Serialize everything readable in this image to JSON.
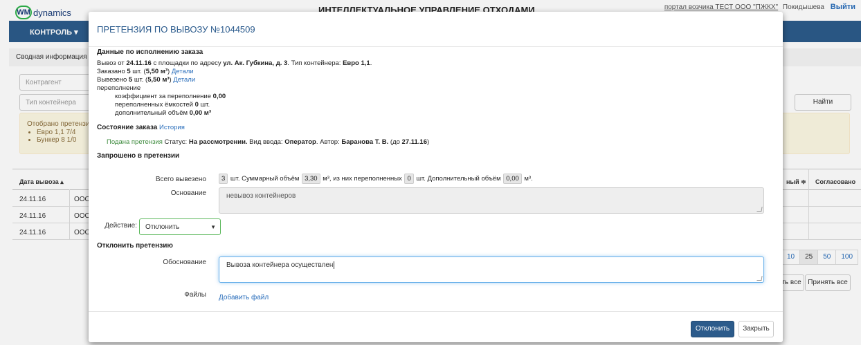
{
  "app": {
    "logo_mark": "WM",
    "logo_text": "dynamics",
    "title": "ИНТЕЛЛЕКТУАЛЬНОЕ УПРАВЛЕНИЕ ОТХОДАМИ",
    "portal": "портал возчика ТЕСТ ООО \"ПЖКХ\"",
    "user": "Покидышева",
    "logout": "Выйти",
    "nav_menu": "КОНТРОЛЬ ▾",
    "breadcrumb": "Сводная информация по",
    "filter_counterparty_placeholder": "Контрагент",
    "filter_container_placeholder": "Тип контейнера",
    "find_button": "Найти",
    "alert_title": "Отобрано претензий",
    "alert_items": [
      "Евро 1,1 7/4",
      "Бункер 8 1/0"
    ],
    "table": {
      "col_date": "Дата вывоза ▴",
      "col_partial": "ный ≑",
      "col_agreed": "Согласовано",
      "rows": [
        {
          "date": "24.11.16",
          "org": "ООО"
        },
        {
          "date": "24.11.16",
          "org": "ООО"
        },
        {
          "date": "24.11.16",
          "org": "ООО"
        }
      ]
    },
    "pager": [
      "10",
      "25",
      "50",
      "100"
    ],
    "reject_all": "ть все",
    "accept_all": "Принять все"
  },
  "modal": {
    "title": "ПРЕТЕНЗИЯ ПО ВЫВОЗУ №1044509",
    "exec_title": "Данные по исполнению заказа",
    "line1_prefix": "Вывоз от ",
    "line1_date": "24.11.16",
    "line1_mid": " с площадки по адресу ",
    "line1_address": "ул. Ак. Губкина, д. 3",
    "line1_mid2": ". Тип контейнера: ",
    "line1_container": "Евро 1,1",
    "line1_end": ".",
    "ordered_prefix": "Заказано ",
    "ordered_count": "5",
    "ordered_mid": " шт. (",
    "ordered_volume": "5,50 м³",
    "ordered_end": ") ",
    "ordered_link": "Детали",
    "exported_prefix": "Вывезено ",
    "exported_count": "5",
    "exported_mid": " шт. (",
    "exported_volume": "5,50 м³",
    "exported_end": ") ",
    "exported_link": "Детали",
    "overflow_label": "переполнение",
    "overflow_coef_label": "коэффициент за переполнение ",
    "overflow_coef": "0,00",
    "overflow_count_label": "переполненных ёмкостей ",
    "overflow_count": "0",
    "overflow_count_unit": " шт.",
    "overflow_extra_label": "дополнительный объём ",
    "overflow_extra": "0,00 м³",
    "state_title": "Состояние заказа",
    "state_link": "История",
    "state_status_green": "Подана претензия",
    "state_status_label": " Статус: ",
    "state_status": "На рассмотрении.",
    "state_input_label": " Вид ввода: ",
    "state_input": "Оператор",
    "state_author_label": ". Автор: ",
    "state_author": "Баранова Т. В.",
    "state_until_prefix": " (до ",
    "state_until": "27.11.16",
    "state_until_end": ")",
    "requested_title": "Запрошено в претензии",
    "total_label": "Всего вывезено",
    "total_count": "3",
    "total_text1": " шт. Суммарный объём ",
    "total_volume": "3,30",
    "total_text2": " м³, из них переполненных ",
    "total_overflow": "0",
    "total_text3": " шт. Дополнительный объём ",
    "total_extra": "0,00",
    "total_text4": " м³.",
    "reason_label": "Основание",
    "reason_value": "невывоз контейнеров",
    "action_label": "Действие:",
    "action_value": "Отклонить",
    "reject_title": "Отклонить претензию",
    "justification_label": "Обоснование",
    "justification_value": "Вывоза контейнера осуществлен",
    "files_label": "Файлы",
    "add_file": "Добавить файл",
    "reject_button": "Отклонить",
    "close_button": "Закрыть"
  }
}
